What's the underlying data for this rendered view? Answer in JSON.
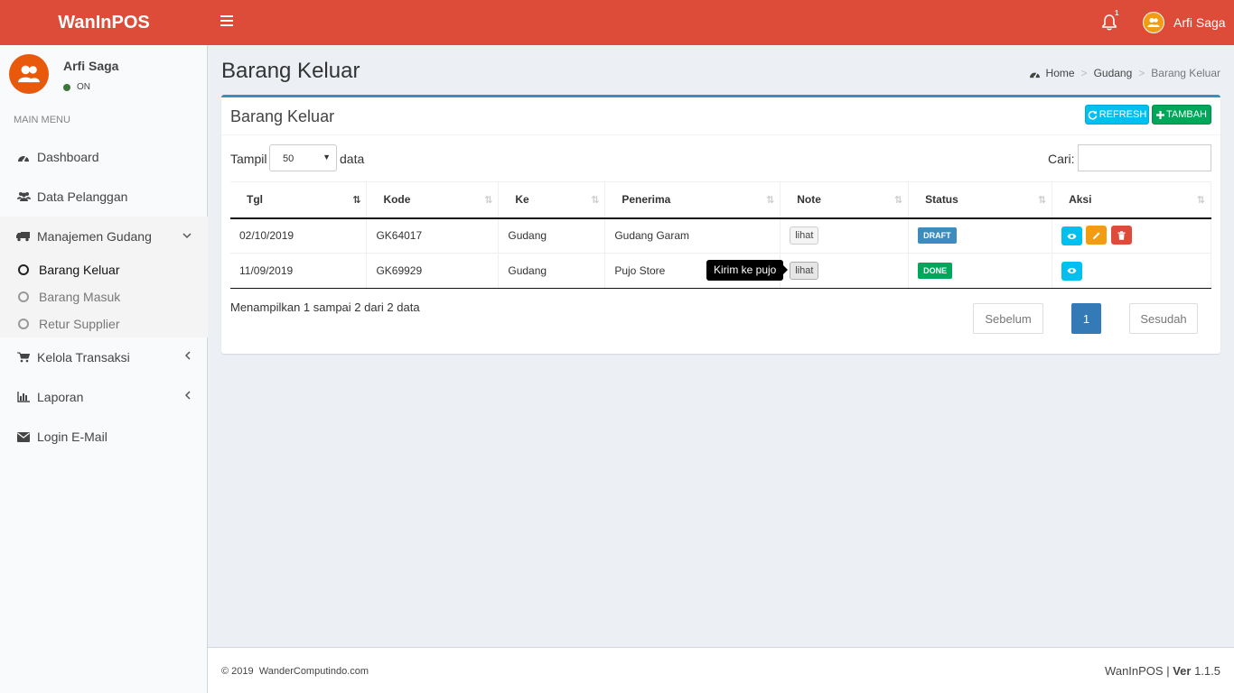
{
  "app": {
    "logo": "WanInPOS",
    "user_name": "Arfi Saga",
    "notif_count": "1"
  },
  "sidebar": {
    "user_name": "Arfi Saga",
    "user_status": "ON",
    "menu_header": "MAIN MENU",
    "items": [
      {
        "label": "Dashboard",
        "icon": "dashboard-icon"
      },
      {
        "label": "Data Pelanggan",
        "icon": "users-icon"
      },
      {
        "label": "Manajemen Gudang",
        "icon": "truck-icon"
      },
      {
        "label": "Kelola Transaksi",
        "icon": "cart-icon"
      },
      {
        "label": "Laporan",
        "icon": "bar-chart-icon"
      },
      {
        "label": "Login E-Mail",
        "icon": "envelope-icon"
      }
    ],
    "sub_items": [
      {
        "label": "Barang Keluar"
      },
      {
        "label": "Barang Masuk"
      },
      {
        "label": "Retur Supplier"
      }
    ]
  },
  "page": {
    "title": "Barang Keluar",
    "breadcrumb": [
      "Home",
      "Gudang",
      "Barang Keluar"
    ]
  },
  "box": {
    "title": "Barang Keluar",
    "refresh_label": "REFRESH",
    "tambah_label": "TAMBAH",
    "length_prefix": "Tampil",
    "length_value": "50",
    "length_suffix": "data",
    "search_label": "Cari:"
  },
  "table": {
    "columns": [
      "Tgl",
      "Kode",
      "Ke",
      "Penerima",
      "Note",
      "Status",
      "Aksi"
    ],
    "rows": [
      {
        "tgl": "02/10/2019",
        "kode": "GK64017",
        "ke": "Gudang",
        "penerima": "Gudang Garam",
        "note": "lihat",
        "status": "DRAFT",
        "status_color": "#3c8dbc"
      },
      {
        "tgl": "11/09/2019",
        "kode": "GK69929",
        "ke": "Gudang",
        "penerima": "Pujo Store",
        "note": "lihat",
        "status": "DONE",
        "status_color": "#00a65a"
      }
    ],
    "tooltip": "Kirim ke pujo",
    "info": "Menampilkan 1 sampai 2 dari 2 data",
    "pagination": {
      "prev": "Sebelum",
      "page": "1",
      "next": "Sesudah"
    }
  },
  "footer": {
    "copyright": "© 2019",
    "company": "WanderComputindo.com",
    "brand": "WanInPOS",
    "ver_label": "Ver",
    "version": "1.1.5"
  }
}
